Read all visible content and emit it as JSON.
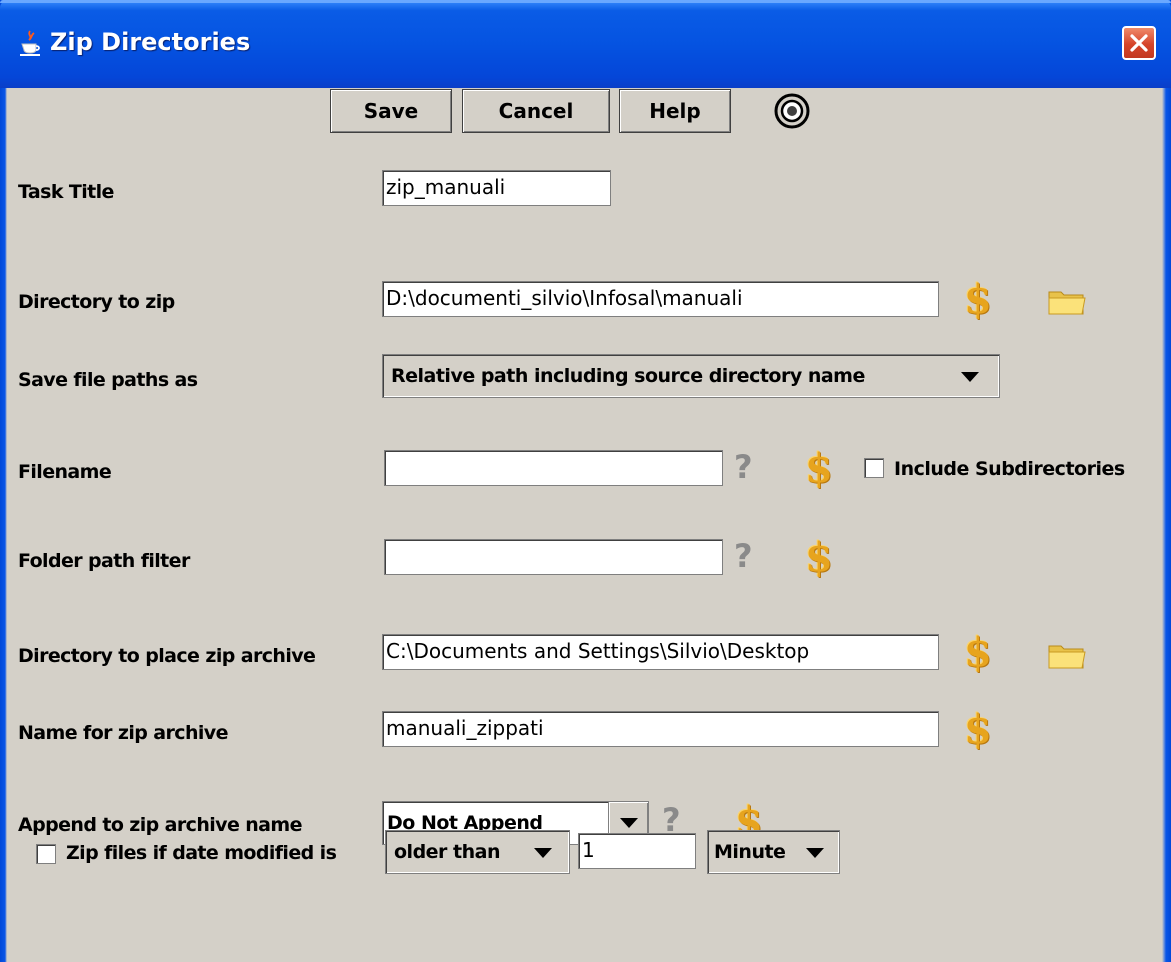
{
  "window": {
    "title": "Zip Directories"
  },
  "toolbar": {
    "save_label": "Save",
    "cancel_label": "Cancel",
    "help_label": "Help"
  },
  "form": {
    "task_title": {
      "label": "Task Title",
      "value": "zip_manuali"
    },
    "directory_to_zip": {
      "label": "Directory to zip",
      "value": "D:\\documenti_silvio\\Infosal\\manuali"
    },
    "save_file_paths": {
      "label": "Save file paths as",
      "value": "Relative path including source directory name"
    },
    "filename": {
      "label": "Filename",
      "value": "",
      "include_subdirectories_label": "Include Subdirectories",
      "include_subdirectories_checked": false
    },
    "folder_path_filter": {
      "label": "Folder path filter",
      "value": ""
    },
    "directory_to_place": {
      "label": "Directory to place zip archive",
      "value": "C:\\Documents and Settings\\Silvio\\Desktop"
    },
    "zip_archive_name": {
      "label": "Name for zip archive",
      "value": "manuali_zippati"
    },
    "append_to_name": {
      "label": "Append to zip archive name",
      "value": "Do Not Append"
    },
    "date_modified": {
      "label": "Zip files if date modified is",
      "checked": false,
      "comparison": "older than",
      "amount": "1",
      "unit": "Minute"
    }
  },
  "icons": {
    "variable": "dollar-icon",
    "help": "question-icon",
    "browse": "folder-icon",
    "app": "java-cup-icon",
    "options": "options-icon"
  },
  "colors": {
    "titlebar": "#0553e1",
    "dialog_background": "#d4d0c8",
    "variable_icon": "#e7a41e"
  }
}
